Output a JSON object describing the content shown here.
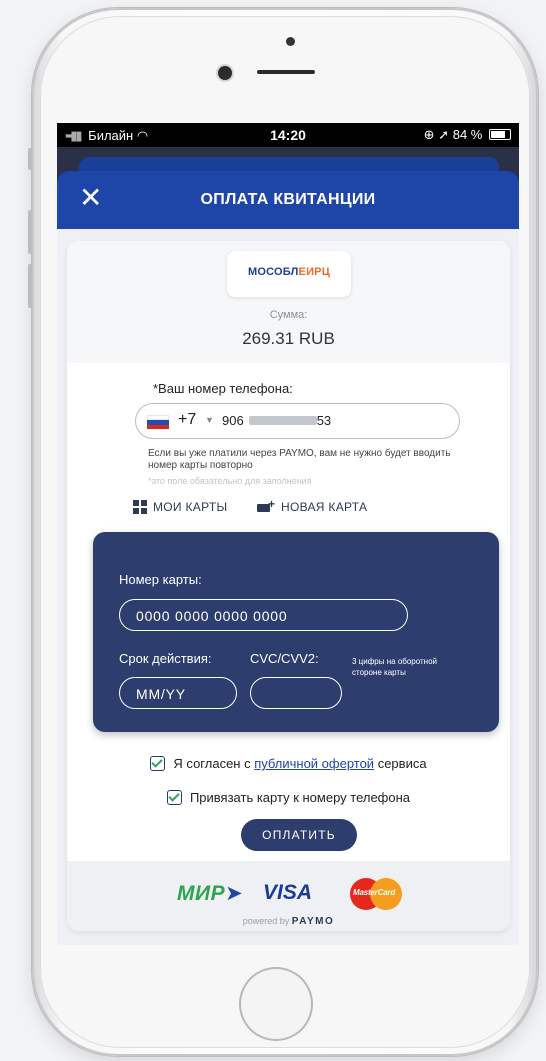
{
  "status_bar": {
    "carrier": "Билайн",
    "time": "14:20",
    "battery": "84 %"
  },
  "header": {
    "title": "ОПЛАТА КВИТАНЦИИ",
    "close_icon": "close-icon"
  },
  "merchant": {
    "logo_prefix": "МОСОБЛ",
    "logo_accent": "ЕИРЦ",
    "sum_label": "Сумма:",
    "sum_value": "269.31 RUB"
  },
  "phone": {
    "label": "*Ваш номер телефона:",
    "country_code": "+7",
    "number_prefix": "906",
    "number_suffix": "53",
    "hint": "Если вы уже платили через PAYMO, вам не нужно будет вводить номер карты повторно",
    "required_note": "*это поле обязательно для заполнения"
  },
  "tabs": {
    "my_cards": "МОИ КАРТЫ",
    "new_card": "НОВАЯ КАРТА"
  },
  "card_form": {
    "number_label": "Номер карты:",
    "number_placeholder": "0000 0000 0000 0000",
    "expiry_label": "Срок действия:",
    "expiry_placeholder": "MM/YY",
    "cvc_label": "CVC/CVV2:",
    "cvc_hint": "3 цифры на оборотной стороне карты"
  },
  "agreement": {
    "prefix": "Я согласен с",
    "link": "публичной офертой",
    "suffix": "сервиса",
    "bind_card": "Привязать карту к номеру телефона"
  },
  "pay_button": "ОПЛАТИТЬ",
  "footer": {
    "mir": "МИР",
    "visa": "VISA",
    "mastercard": "MasterCard",
    "powered_by": "powered by",
    "paymo": "PAYMO"
  },
  "colors": {
    "header": "#1e46a9",
    "card_form": "#2d3e6e",
    "check": "#2fa360"
  }
}
